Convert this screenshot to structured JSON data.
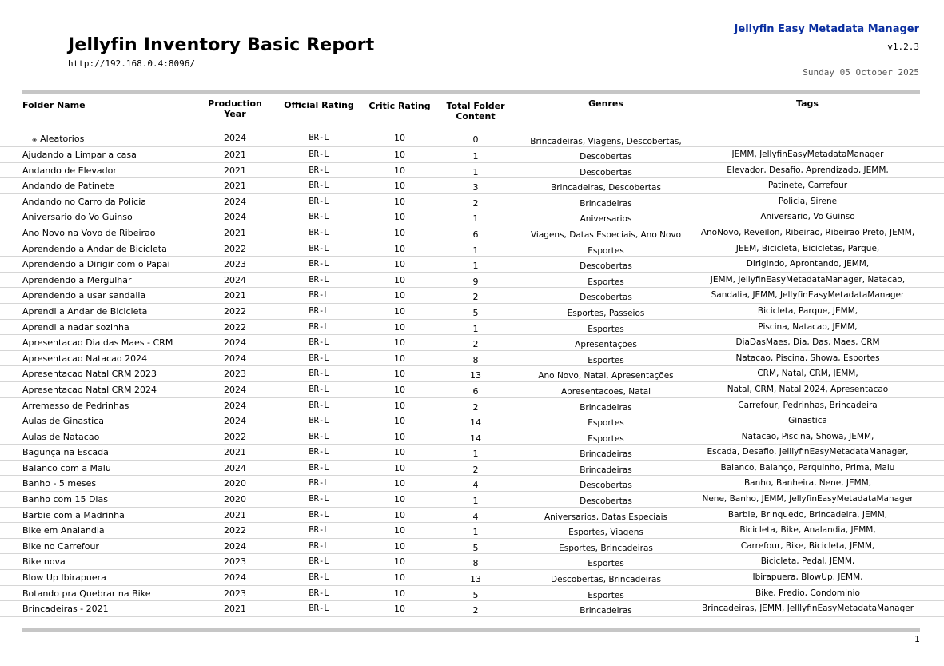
{
  "report": {
    "title": "Jellyfin Inventory Basic Report",
    "url": "http://192.168.0.4:8096/",
    "app_name": "Jellyfin Easy Metadata Manager",
    "version": "v1.2.3",
    "date": "Sunday 05 October 2025",
    "page_number": "1"
  },
  "columns": {
    "folder_name": "Folder Name",
    "production_year_1": "Production",
    "production_year_2": "Year",
    "official_rating": "Official Rating",
    "critic_rating": "Critic Rating",
    "total_1": "Total Folder",
    "total_2": "Content",
    "genres": "Genres",
    "tags": "Tags"
  },
  "rows": [
    {
      "name": "Aleatorios",
      "year": "2024",
      "rating": "BR-L",
      "critic": "10",
      "total": "0",
      "genres": "Brincadeiras, Viagens, Descobertas,",
      "tags": ""
    },
    {
      "name": "Ajudando a Limpar a casa",
      "year": "2021",
      "rating": "BR-L",
      "critic": "10",
      "total": "1",
      "genres": "Descobertas",
      "tags": "JEMM, JellyfinEasyMetadataManager"
    },
    {
      "name": "Andando de Elevador",
      "year": "2021",
      "rating": "BR-L",
      "critic": "10",
      "total": "1",
      "genres": "Descobertas",
      "tags": "Elevador, Desafio, Aprendizado, JEMM,"
    },
    {
      "name": "Andando de Patinete",
      "year": "2021",
      "rating": "BR-L",
      "critic": "10",
      "total": "3",
      "genres": "Brincadeiras, Descobertas",
      "tags": "Patinete, Carrefour"
    },
    {
      "name": "Andando no Carro da Policia",
      "year": "2024",
      "rating": "BR-L",
      "critic": "10",
      "total": "2",
      "genres": "Brincadeiras",
      "tags": "Policia, Sirene"
    },
    {
      "name": "Aniversario do Vo Guinso",
      "year": "2024",
      "rating": "BR-L",
      "critic": "10",
      "total": "1",
      "genres": "Aniversarios",
      "tags": "Aniversario, Vo Guinso"
    },
    {
      "name": "Ano Novo na Vovo de Ribeirao",
      "year": "2021",
      "rating": "BR-L",
      "critic": "10",
      "total": "6",
      "genres": "Viagens, Datas Especiais, Ano Novo",
      "tags": "AnoNovo, Reveilon, Ribeirao, Ribeirao Preto, JEMM,"
    },
    {
      "name": "Aprendendo a Andar de Bicicleta",
      "year": "2022",
      "rating": "BR-L",
      "critic": "10",
      "total": "1",
      "genres": "Esportes",
      "tags": "JEEM, Bicicleta, Bicicletas, Parque,"
    },
    {
      "name": "Aprendendo a Dirigir com o Papai",
      "year": "2023",
      "rating": "BR-L",
      "critic": "10",
      "total": "1",
      "genres": "Descobertas",
      "tags": "Dirigindo, Aprontando, JEMM,"
    },
    {
      "name": "Aprendendo a Mergulhar",
      "year": "2024",
      "rating": "BR-L",
      "critic": "10",
      "total": "9",
      "genres": "Esportes",
      "tags": "JEMM, JellyfinEasyMetadataManager, Natacao,"
    },
    {
      "name": "Aprendendo a usar sandalia",
      "year": "2021",
      "rating": "BR-L",
      "critic": "10",
      "total": "2",
      "genres": "Descobertas",
      "tags": "Sandalia, JEMM, JellyfinEasyMetadataManager"
    },
    {
      "name": "Aprendi a Andar de Bicicleta",
      "year": "2022",
      "rating": "BR-L",
      "critic": "10",
      "total": "5",
      "genres": "Esportes, Passeios",
      "tags": "Bicicleta, Parque, JEMM,"
    },
    {
      "name": "Aprendi a nadar sozinha",
      "year": "2022",
      "rating": "BR-L",
      "critic": "10",
      "total": "1",
      "genres": "Esportes",
      "tags": "Piscina, Natacao, JEMM,"
    },
    {
      "name": "Apresentacao Dia das Maes - CRM",
      "year": "2024",
      "rating": "BR-L",
      "critic": "10",
      "total": "2",
      "genres": "Apresentações",
      "tags": "DiaDasMaes, Dia, Das, Maes, CRM"
    },
    {
      "name": "Apresentacao Natacao 2024",
      "year": "2024",
      "rating": "BR-L",
      "critic": "10",
      "total": "8",
      "genres": "Esportes",
      "tags": "Natacao, Piscina, Showa, Esportes"
    },
    {
      "name": "Apresentacao Natal CRM 2023",
      "year": "2023",
      "rating": "BR-L",
      "critic": "10",
      "total": "13",
      "genres": "Ano Novo, Natal, Apresentações",
      "tags": "CRM, Natal, CRM, JEMM,"
    },
    {
      "name": "Apresentacao Natal CRM 2024",
      "year": "2024",
      "rating": "BR-L",
      "critic": "10",
      "total": "6",
      "genres": "Apresentacoes, Natal",
      "tags": "Natal, CRM, Natal 2024, Apresentacao"
    },
    {
      "name": "Arremesso de Pedrinhas",
      "year": "2024",
      "rating": "BR-L",
      "critic": "10",
      "total": "2",
      "genres": "Brincadeiras",
      "tags": "Carrefour, Pedrinhas, Brincadeira"
    },
    {
      "name": "Aulas de Ginastica",
      "year": "2024",
      "rating": "BR-L",
      "critic": "10",
      "total": "14",
      "genres": "Esportes",
      "tags": "Ginastica"
    },
    {
      "name": "Aulas de Natacao",
      "year": "2022",
      "rating": "BR-L",
      "critic": "10",
      "total": "14",
      "genres": "Esportes",
      "tags": "Natacao, Piscina, Showa, JEMM,"
    },
    {
      "name": "Bagunça na Escada",
      "year": "2021",
      "rating": "BR-L",
      "critic": "10",
      "total": "1",
      "genres": "Brincadeiras",
      "tags": "Escada, Desafio, JelllyfinEasyMetadataManager,"
    },
    {
      "name": "Balanco com a Malu",
      "year": "2024",
      "rating": "BR-L",
      "critic": "10",
      "total": "2",
      "genres": "Brincadeiras",
      "tags": "Balanco, Balanço, Parquinho, Prima, Malu"
    },
    {
      "name": "Banho - 5 meses",
      "year": "2020",
      "rating": "BR-L",
      "critic": "10",
      "total": "4",
      "genres": "Descobertas",
      "tags": "Banho, Banheira, Nene, JEMM,"
    },
    {
      "name": "Banho com 15 Dias",
      "year": "2020",
      "rating": "BR-L",
      "critic": "10",
      "total": "1",
      "genres": "Descobertas",
      "tags": "Nene, Banho, JEMM, JellyfinEasyMetadataManager"
    },
    {
      "name": "Barbie com a Madrinha",
      "year": "2021",
      "rating": "BR-L",
      "critic": "10",
      "total": "4",
      "genres": "Aniversarios, Datas Especiais",
      "tags": "Barbie, Brinquedo, Brincadeira, JEMM,"
    },
    {
      "name": "Bike em Analandia",
      "year": "2022",
      "rating": "BR-L",
      "critic": "10",
      "total": "1",
      "genres": "Esportes, Viagens",
      "tags": "Bicicleta, Bike, Analandia, JEMM,"
    },
    {
      "name": "Bike no Carrefour",
      "year": "2024",
      "rating": "BR-L",
      "critic": "10",
      "total": "5",
      "genres": "Esportes, Brincadeiras",
      "tags": "Carrefour, Bike, Bicicleta, JEMM,"
    },
    {
      "name": "Bike nova",
      "year": "2023",
      "rating": "BR-L",
      "critic": "10",
      "total": "8",
      "genres": "Esportes",
      "tags": "Bicicleta, Pedal, JEMM,"
    },
    {
      "name": "Blow Up Ibirapuera",
      "year": "2024",
      "rating": "BR-L",
      "critic": "10",
      "total": "13",
      "genres": "Descobertas, Brincadeiras",
      "tags": "Ibirapuera, BlowUp, JEMM,"
    },
    {
      "name": "Botando pra Quebrar na Bike",
      "year": "2023",
      "rating": "BR-L",
      "critic": "10",
      "total": "5",
      "genres": "Esportes",
      "tags": "Bike, Predio, Condominio"
    },
    {
      "name": "Brincadeiras - 2021",
      "year": "2021",
      "rating": "BR-L",
      "critic": "10",
      "total": "2",
      "genres": "Brincadeiras",
      "tags": "Brincadeiras, JEMM, JelllyfinEasyMetadataManager"
    }
  ]
}
